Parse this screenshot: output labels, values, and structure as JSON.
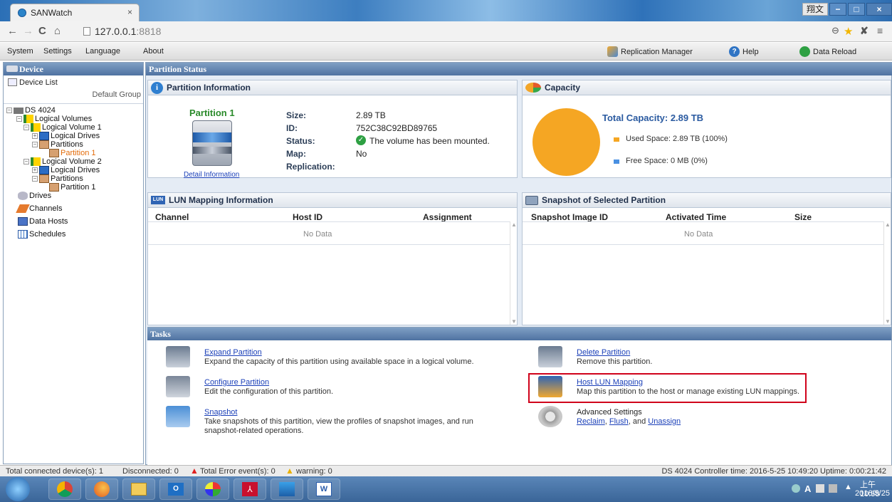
{
  "browser": {
    "tab_title": "SANWatch",
    "tab_close": "×",
    "url_host": "127.0.0.1",
    "url_port": ":8818",
    "win_buttons": [
      "翔文",
      "−",
      "□",
      "×"
    ]
  },
  "menu": {
    "items": [
      "System",
      "Settings",
      "Language",
      "About"
    ],
    "replication_manager": "Replication Manager",
    "help": "Help",
    "data_reload": "Data Reload"
  },
  "left": {
    "header": "Device",
    "device_list": "Device List",
    "default_group": "Default Group",
    "tree": {
      "ds": "DS 4024",
      "logical_volumes": "Logical Volumes",
      "lv1": "Logical Volume 1",
      "lv1_ld": "Logical Drives",
      "lv1_parts": "Partitions",
      "lv1_p1": "Partition 1",
      "lv2": "Logical Volume 2",
      "lv2_ld": "Logical Drives",
      "lv2_parts": "Partitions",
      "lv2_p1": "Partition 1",
      "drives": "Drives",
      "channels": "Channels",
      "data_hosts": "Data Hosts",
      "schedules": "Schedules"
    }
  },
  "main": {
    "header": "Partition Status",
    "partition_info": {
      "title": "Partition Information",
      "name": "Partition 1",
      "detail_link": "Detail Information",
      "size_label": "Size:",
      "size": "2.89 TB",
      "id_label": "ID:",
      "id": "752C38C92BD89765",
      "status_label": "Status:",
      "status": "The volume has been mounted.",
      "map_label": "Map:",
      "map": "No",
      "replication_label": "Replication:",
      "replication": ""
    },
    "capacity": {
      "title": "Capacity",
      "total": "Total Capacity: 2.89 TB",
      "used": "Used Space: 2.89 TB (100%)",
      "free": "Free Space: 0 MB (0%)",
      "used_color": "#f5a623",
      "free_color": "#4a90e2",
      "used_fraction": 1.0
    },
    "lun": {
      "title": "LUN Mapping Information",
      "columns": [
        "Channel",
        "Host ID",
        "Assignment"
      ],
      "empty": "No Data"
    },
    "snapshot": {
      "title": "Snapshot of Selected Partition",
      "columns": [
        "Snapshot Image ID",
        "Activated Time",
        "Size"
      ],
      "empty": "No Data"
    }
  },
  "tasks": {
    "header": "Tasks",
    "expand": {
      "label": "Expand Partition",
      "desc": "Expand the capacity of this partition using available space in a logical volume."
    },
    "configure": {
      "label": "Configure Partition",
      "desc": "Edit the configuration of this partition."
    },
    "snapshot": {
      "label": "Snapshot",
      "desc1": "Take snapshots of this partition, view the profiles of snapshot images, and run",
      "desc2": "snapshot-related operations."
    },
    "delete": {
      "label": "Delete Partition",
      "desc": "Remove this partition."
    },
    "host_lun": {
      "label": "Host LUN Mapping",
      "desc": "Map this partition to the host or manage existing LUN mappings."
    },
    "advanced": {
      "label": "Advanced Settings",
      "reclaim": "Reclaim",
      "sep1": ", ",
      "flush": "Flush",
      "sep2": ", and ",
      "unassign": "Unassign"
    }
  },
  "status": {
    "connected": "Total connected device(s): 1",
    "disconnected": "Disconnected: 0",
    "errors": "Total Error event(s): 0",
    "warning": "warning: 0",
    "right": "DS 4024  Controller time: 2016-5-25 10:49:20  Uptime: 0:00:21:42"
  },
  "taskbar": {
    "time": "上午 10:58",
    "date": "2016/5/25",
    "tray": "A"
  }
}
